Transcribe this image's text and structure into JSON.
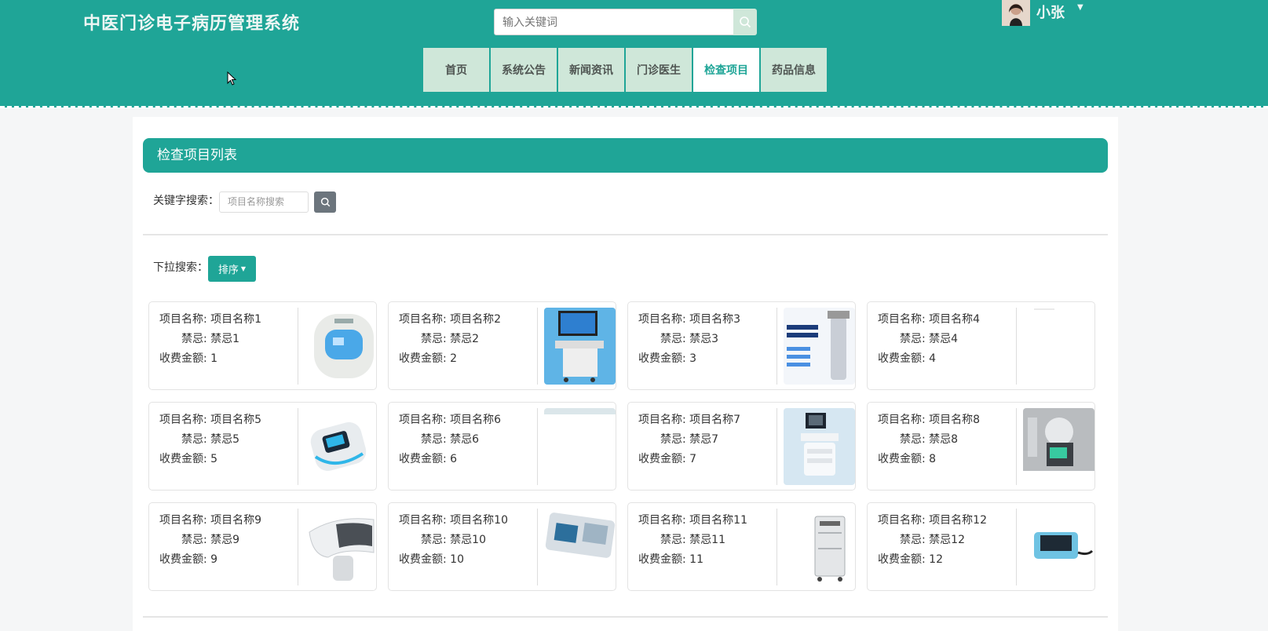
{
  "header": {
    "site_title": "中医门诊电子病历管理系统",
    "search_placeholder": "输入关键词",
    "user_name": "小张",
    "nav": [
      {
        "label": "首页",
        "active": false
      },
      {
        "label": "系统公告",
        "active": false
      },
      {
        "label": "新闻资讯",
        "active": false
      },
      {
        "label": "门诊医生",
        "active": false
      },
      {
        "label": "检查项目",
        "active": true
      },
      {
        "label": "药品信息",
        "active": false
      }
    ]
  },
  "panel": {
    "title": "检查项目列表",
    "keyword_label": "关键字搜索：",
    "keyword_placeholder": "项目名称搜索",
    "dropdown_label": "下拉搜索：",
    "sort_label": "排序"
  },
  "card_labels": {
    "name": "项目名称:",
    "taboo": "禁忌:",
    "fee": "收费金额:"
  },
  "items": [
    {
      "name": "项目名称1",
      "taboo": "禁忌1",
      "fee": "1",
      "image": "massage-device-icon"
    },
    {
      "name": "项目名称2",
      "taboo": "禁忌2",
      "fee": "2",
      "image": "ultrasound-cart-icon"
    },
    {
      "name": "项目名称3",
      "taboo": "禁忌3",
      "fee": "3",
      "image": "red-light-therapy-poster-icon"
    },
    {
      "name": "项目名称4",
      "taboo": "禁忌4",
      "fee": "4",
      "image": "blank-image-icon"
    },
    {
      "name": "项目名称5",
      "taboo": "禁忌5",
      "fee": "5",
      "image": "portable-monitor-icon"
    },
    {
      "name": "项目名称6",
      "taboo": "禁忌6",
      "fee": "6",
      "image": "blank-image-icon"
    },
    {
      "name": "项目名称7",
      "taboo": "禁忌7",
      "fee": "7",
      "image": "medical-cart-icon"
    },
    {
      "name": "项目名称8",
      "taboo": "禁忌8",
      "fee": "8",
      "image": "lab-equipment-icon"
    },
    {
      "name": "项目名称9",
      "taboo": "禁忌9",
      "fee": "9",
      "image": "handheld-scanner-icon"
    },
    {
      "name": "项目名称10",
      "taboo": "禁忌10",
      "fee": "10",
      "image": "infusion-pump-icon"
    },
    {
      "name": "项目名称11",
      "taboo": "禁忌11",
      "fee": "11",
      "image": "cabinet-device-icon"
    },
    {
      "name": "项目名称12",
      "taboo": "禁忌12",
      "fee": "12",
      "image": "tabletop-device-icon"
    }
  ],
  "colors": {
    "primary": "#1fa597",
    "nav_bg": "#cfe7d9",
    "sort_button": "#1fa597",
    "keyword_button": "#6c757d"
  }
}
